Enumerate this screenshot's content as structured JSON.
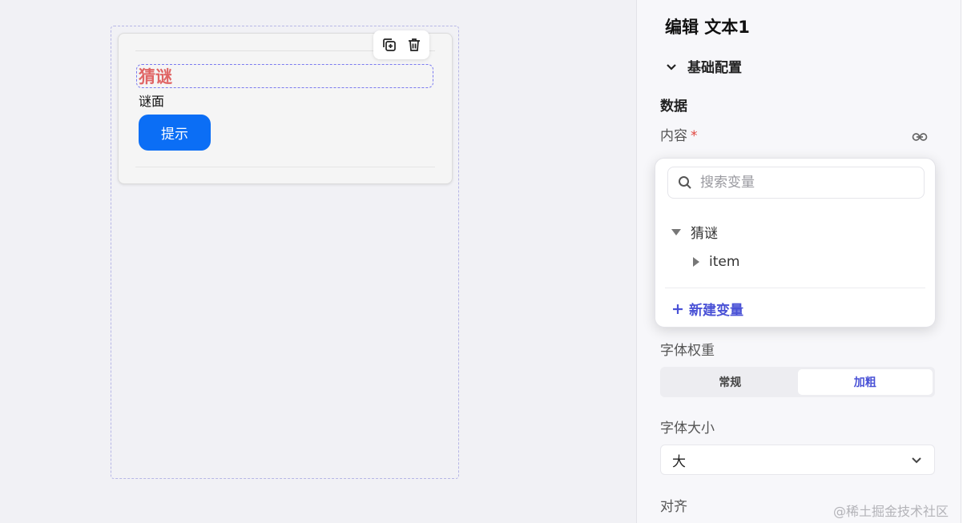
{
  "canvas": {
    "riddle_title": "猜谜",
    "riddle_face": "谜面",
    "hint_button": "提示",
    "toolbar": {
      "icons": [
        "duplicate-icon",
        "trash-icon"
      ]
    }
  },
  "panel": {
    "title": "编辑 文本1",
    "section": "基础配置",
    "group_data": "数据",
    "content_label": "内容",
    "required_mark": "*",
    "font_weight_label": "字体权重",
    "font_weight_options": [
      "常规",
      "加粗"
    ],
    "font_weight_selected": "加粗",
    "font_size_label": "字体大小",
    "font_size_value": "大",
    "align_label": "对齐"
  },
  "dropdown": {
    "search_placeholder": "搜索变量",
    "tree": [
      {
        "label": "猜谜",
        "expanded": true,
        "children": [
          {
            "label": "item",
            "expanded": false
          }
        ]
      }
    ],
    "new_variable": "新建变量"
  },
  "watermark": "@稀土掘金技术社区",
  "colors": {
    "accent": "#4a52d6",
    "primary_button": "#0b6ef5",
    "title_red": "#e06565",
    "required_red": "#e0453e"
  }
}
